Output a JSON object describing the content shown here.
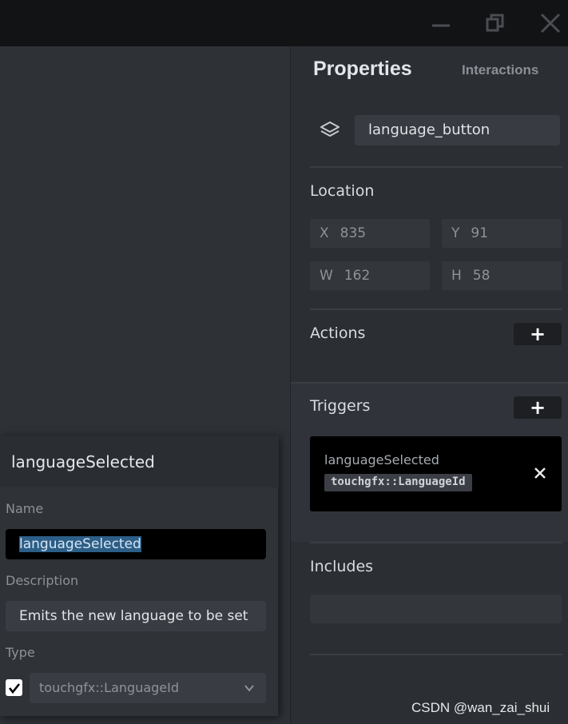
{
  "window": {
    "minimize_icon": "minimize-icon",
    "maximize_icon": "restore-icon",
    "close_icon": "close-icon"
  },
  "properties_panel": {
    "tabs": [
      {
        "label": "Properties",
        "active": true
      },
      {
        "label": "Interactions",
        "active": false
      }
    ],
    "widget_name": "language_button",
    "location": {
      "title": "Location",
      "x_label": "X",
      "x": "835",
      "y_label": "Y",
      "y": "91",
      "w_label": "W",
      "w": "162",
      "h_label": "H",
      "h": "58"
    },
    "actions": {
      "title": "Actions",
      "add_label": "+"
    },
    "triggers": {
      "title": "Triggers",
      "add_label": "+",
      "items": [
        {
          "name": "languageSelected",
          "type": "touchgfx::LanguageId"
        }
      ]
    },
    "includes": {
      "title": "Includes"
    }
  },
  "trigger_editor": {
    "title": "languageSelected",
    "name_label": "Name",
    "name_value": "languageSelected",
    "description_label": "Description",
    "description_value": "Emits the new language to be set",
    "type_label": "Type",
    "type_checked": true,
    "type_value": "touchgfx::LanguageId"
  },
  "watermark": "CSDN @wan_zai_shui",
  "colors": {
    "titlebar": "#111315",
    "panel_bg": "#2b2e33",
    "input_bg": "#393c42",
    "selection": "#2c5e86",
    "card_bg": "#000000"
  }
}
